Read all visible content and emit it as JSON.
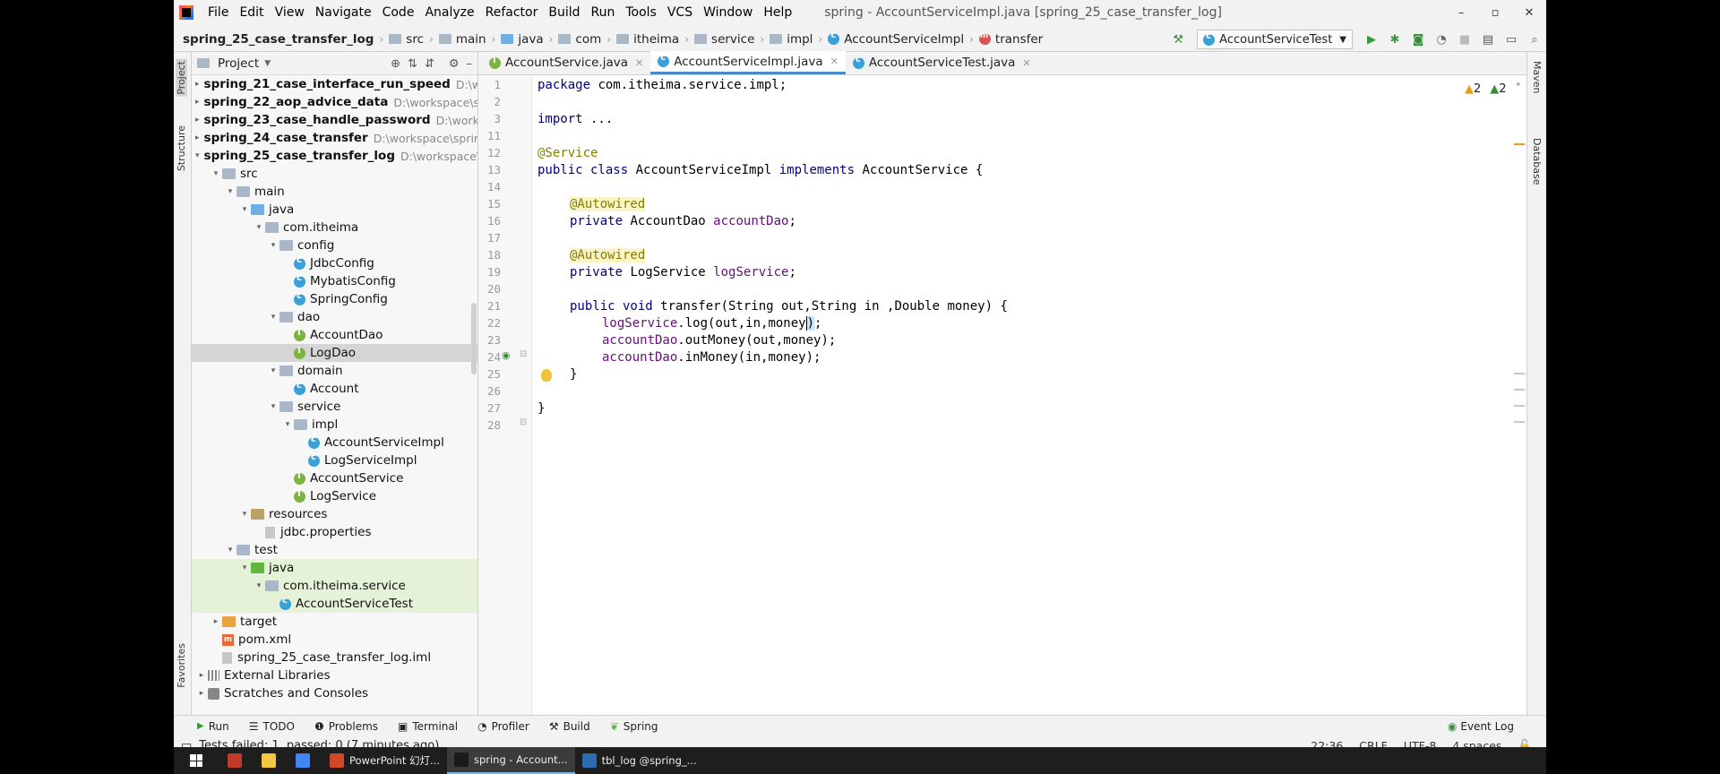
{
  "menu": {
    "items": [
      "File",
      "Edit",
      "View",
      "Navigate",
      "Code",
      "Analyze",
      "Refactor",
      "Build",
      "Run",
      "Tools",
      "VCS",
      "Window",
      "Help"
    ],
    "title": "spring - AccountServiceImpl.java [spring_25_case_transfer_log]"
  },
  "window": {
    "minimize": "–",
    "restore": "▫",
    "close": "✕"
  },
  "breadcrumb": {
    "project": "spring_25_case_transfer_log",
    "parts": [
      "src",
      "main",
      "java",
      "com",
      "itheima",
      "service",
      "impl",
      "AccountServiceImpl",
      "transfer"
    ]
  },
  "run_config": {
    "name": "AccountServiceTest"
  },
  "side_tabs": {
    "project": "Project",
    "structure": "Structure",
    "favorites": "Favorites",
    "maven": "Maven",
    "database": "Database"
  },
  "project_panel": {
    "title": "Project",
    "tree": [
      {
        "label": "spring_21_case_interface_run_speed",
        "path": "D:\\work",
        "depth": 0,
        "kind": "module",
        "arrow": "▸"
      },
      {
        "label": "spring_22_aop_advice_data",
        "path": "D:\\workspace\\sp",
        "depth": 0,
        "kind": "module",
        "arrow": "▸"
      },
      {
        "label": "spring_23_case_handle_password",
        "path": "D:\\worksp",
        "depth": 0,
        "kind": "module",
        "arrow": "▸"
      },
      {
        "label": "spring_24_case_transfer",
        "path": "D:\\workspace\\spring",
        "depth": 0,
        "kind": "module",
        "arrow": "▸"
      },
      {
        "label": "spring_25_case_transfer_log",
        "path": "D:\\workspace\\s",
        "depth": 0,
        "kind": "module",
        "arrow": "▾"
      },
      {
        "label": "src",
        "depth": 1,
        "kind": "folder",
        "arrow": "▾"
      },
      {
        "label": "main",
        "depth": 2,
        "kind": "folder",
        "arrow": "▾"
      },
      {
        "label": "java",
        "depth": 3,
        "kind": "folder-blue",
        "arrow": "▾"
      },
      {
        "label": "com.itheima",
        "depth": 4,
        "kind": "package",
        "arrow": "▾"
      },
      {
        "label": "config",
        "depth": 5,
        "kind": "package",
        "arrow": "▾"
      },
      {
        "label": "JdbcConfig",
        "depth": 6,
        "kind": "class"
      },
      {
        "label": "MybatisConfig",
        "depth": 6,
        "kind": "class"
      },
      {
        "label": "SpringConfig",
        "depth": 6,
        "kind": "class"
      },
      {
        "label": "dao",
        "depth": 5,
        "kind": "package",
        "arrow": "▾"
      },
      {
        "label": "AccountDao",
        "depth": 6,
        "kind": "interface"
      },
      {
        "label": "LogDao",
        "depth": 6,
        "kind": "interface",
        "selected": true
      },
      {
        "label": "domain",
        "depth": 5,
        "kind": "package",
        "arrow": "▾"
      },
      {
        "label": "Account",
        "depth": 6,
        "kind": "class"
      },
      {
        "label": "service",
        "depth": 5,
        "kind": "package",
        "arrow": "▾"
      },
      {
        "label": "impl",
        "depth": 6,
        "kind": "package",
        "arrow": "▾"
      },
      {
        "label": "AccountServiceImpl",
        "depth": 7,
        "kind": "class"
      },
      {
        "label": "LogServiceImpl",
        "depth": 7,
        "kind": "class"
      },
      {
        "label": "AccountService",
        "depth": 6,
        "kind": "interface"
      },
      {
        "label": "LogService",
        "depth": 6,
        "kind": "interface"
      },
      {
        "label": "resources",
        "depth": 3,
        "kind": "folder-res",
        "arrow": "▾"
      },
      {
        "label": "jdbc.properties",
        "depth": 4,
        "kind": "file"
      },
      {
        "label": "test",
        "depth": 2,
        "kind": "folder",
        "arrow": "▾"
      },
      {
        "label": "java",
        "depth": 3,
        "kind": "folder-green",
        "arrow": "▾",
        "test": true
      },
      {
        "label": "com.itheima.service",
        "depth": 4,
        "kind": "package",
        "arrow": "▾",
        "test": true
      },
      {
        "label": "AccountServiceTest",
        "depth": 5,
        "kind": "class",
        "test": true
      },
      {
        "label": "target",
        "depth": 1,
        "kind": "folder-orange",
        "arrow": "▸"
      },
      {
        "label": "pom.xml",
        "depth": 1,
        "kind": "maven"
      },
      {
        "label": "spring_25_case_transfer_log.iml",
        "depth": 1,
        "kind": "file"
      },
      {
        "label": "External Libraries",
        "depth": 0,
        "kind": "lib",
        "arrow": "▸"
      },
      {
        "label": "Scratches and Consoles",
        "depth": 0,
        "kind": "scratch",
        "arrow": "▸"
      }
    ]
  },
  "editor": {
    "tabs": [
      {
        "label": "AccountService.java",
        "kind": "interface",
        "active": false
      },
      {
        "label": "AccountServiceImpl.java",
        "kind": "class",
        "active": true
      },
      {
        "label": "AccountServiceTest.java",
        "kind": "class",
        "active": false
      }
    ],
    "warnings": {
      "yellow": "2",
      "green": "2"
    },
    "line_numbers": [
      "1",
      "2",
      "3",
      "11",
      "12",
      "13",
      "14",
      "15",
      "16",
      "17",
      "18",
      "19",
      "20",
      "21",
      "22",
      "23",
      "24",
      "25",
      "26",
      "27",
      "28"
    ],
    "code": {
      "l1_kw": "package",
      "l1_rest": " com.itheima.service.impl;",
      "l3_kw": "import",
      "l3_rest": " ...",
      "l12": "@Service",
      "l13_a": "public class",
      "l13_b": " AccountServiceImpl ",
      "l13_c": "implements",
      "l13_d": " AccountService {",
      "l15": "@Autowired",
      "l16_kw": "private",
      "l16_type": " AccountDao ",
      "l16_fld": "accountDao",
      "l16_end": ";",
      "l18": "@Autowired",
      "l19_kw": "private",
      "l19_type": " LogService ",
      "l19_fld": "logService",
      "l19_end": ";",
      "l21_kw": "public void",
      "l21_rest": " transfer(String out,String in ,Double money) {",
      "l22_fld": "logService",
      "l22_rest": ".log(out,in,money",
      "l22_brace": ")",
      "l22_end": ";",
      "l23_fld": "accountDao",
      "l23_rest": ".outMoney(out,money);",
      "l24_fld": "accountDao",
      "l24_rest": ".inMoney(in,money);",
      "l25": "}",
      "l27": "}"
    }
  },
  "bottom_tools": [
    "Run",
    "TODO",
    "Problems",
    "Terminal",
    "Profiler",
    "Build",
    "Spring"
  ],
  "event_log": "Event Log",
  "status": {
    "message": "Tests failed: 1, passed: 0 (7 minutes ago)",
    "position": "22:36",
    "line_sep": "CRLF",
    "encoding": "UTF-8",
    "indent": "4 spaces"
  },
  "taskbar": {
    "apps": [
      {
        "label": "",
        "color": "#c0392b"
      },
      {
        "label": "",
        "color": "#f4c542"
      },
      {
        "label": "",
        "color": "#4285f4"
      },
      {
        "label": "PowerPoint 幻灯...",
        "color": "#d24726"
      },
      {
        "label": "spring - Account...",
        "color": "#1a1a1a",
        "active": true
      },
      {
        "label": "tbl_log @spring_...",
        "color": "#2b6cb0"
      }
    ]
  }
}
